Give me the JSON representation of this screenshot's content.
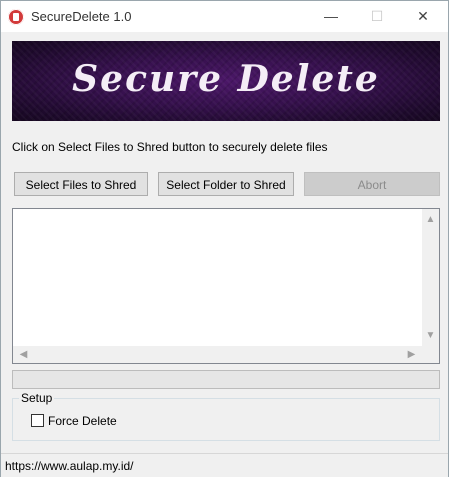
{
  "window": {
    "title": "SecureDelete 1.0"
  },
  "controls": {
    "minimize": "—",
    "maximize": "☐",
    "close": "✕"
  },
  "banner": {
    "text": "Secure Delete"
  },
  "instruction": "Click on Select Files to Shred button to securely delete files",
  "buttons": {
    "select_files": "Select Files to Shred",
    "select_folder": "Select Folder to Shred",
    "abort": "Abort"
  },
  "file_list": {
    "items": []
  },
  "scroll_arrows": {
    "up": "▲",
    "down": "▼",
    "left": "◀",
    "right": "▶"
  },
  "progress": {
    "value": 0
  },
  "setup": {
    "label": "Setup",
    "force_delete_label": "Force Delete",
    "force_delete_checked": false
  },
  "status": {
    "text": "https://www.aulap.my.id/"
  },
  "colors": {
    "banner_bg": "#35104c",
    "progress_fill": "#06b025"
  }
}
